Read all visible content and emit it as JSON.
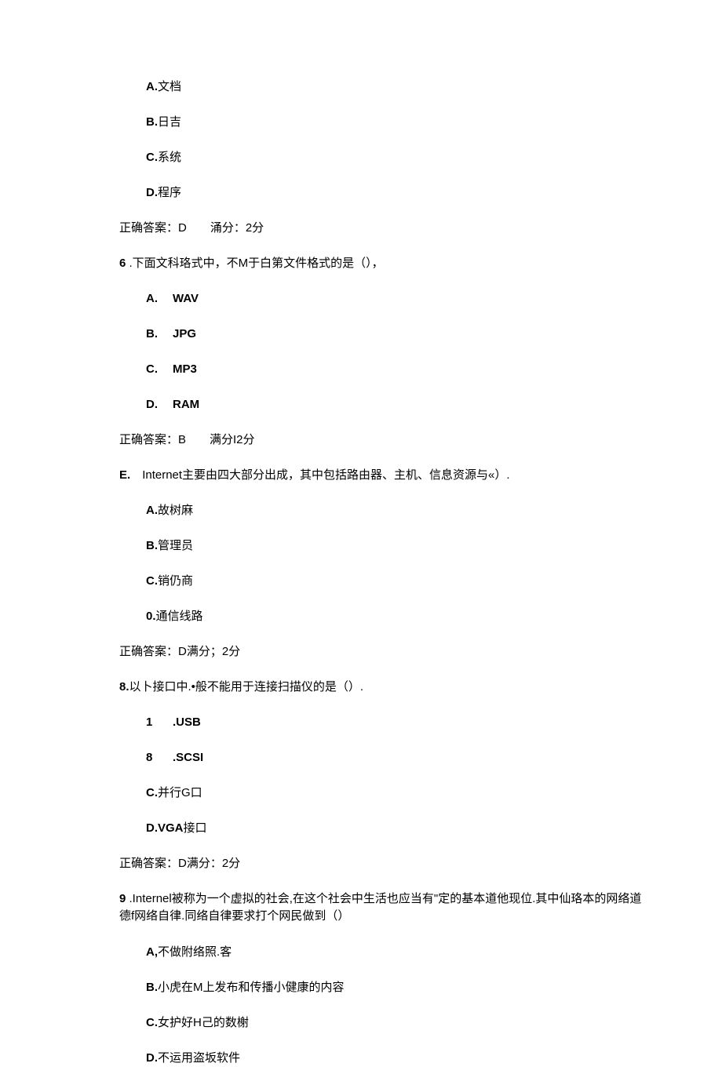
{
  "q5": {
    "optA": {
      "label": "A.",
      "text": "文档"
    },
    "optB": {
      "label": "B.",
      "text": "日吉"
    },
    "optC": {
      "label": "C.",
      "text": "系统"
    },
    "optD": {
      "label": "D.",
      "text": "程序"
    },
    "answer": "正确答案：D　　涌分：2分"
  },
  "q6": {
    "stem_num": "6",
    "stem_text": " .下面文科珞式中，不M于白第文件格式的是（），",
    "optA": {
      "label": "A.",
      "text": "WAV"
    },
    "optB": {
      "label": "B.",
      "text": "JPG"
    },
    "optC": {
      "label": "C.",
      "text": "MP3"
    },
    "optD": {
      "label": "D.",
      "text": "RAM"
    },
    "answer": "正确答案：B　　满分I2分"
  },
  "q7": {
    "stem_num": "E.",
    "stem_text": "　Internet主要由四大部分出成，其中包括路由器、主机、信息资源与«）.",
    "optA": {
      "label": "A.",
      "text": "故树麻"
    },
    "optB": {
      "label": "B.",
      "text": "管理员"
    },
    "optC": {
      "label": "C.",
      "text": "销仍商"
    },
    "optD": {
      "label": "0.",
      "text": "通信线路"
    },
    "answer": "正确答案：D满分；2分"
  },
  "q8": {
    "stem_num": "8.",
    "stem_text": "以卜接口中.•般不能用于连接扫描仪的是（）.",
    "optA": {
      "label": "1",
      "text": ".USB"
    },
    "optB": {
      "label": "8",
      "text": ".SCSI"
    },
    "optC": {
      "label": "C.",
      "text": "并行G口"
    },
    "optD": {
      "label": "D.VGA",
      "text": "接口"
    },
    "answer": "正确答案：D满分：2分"
  },
  "q9": {
    "stem_num": "9",
    "stem_text": " .Internel被称为一个虚拟的社会,在这个社会中生活也应当有\"定的基本道他现位.其中仙珞本的网络道德f网络自律.同络自律要求打个网民做到（）",
    "optA": {
      "label": "A,",
      "text": "不做附络照.客"
    },
    "optB": {
      "label": "B.",
      "text": "小虎在M上发布和传播小健康的内容"
    },
    "optC": {
      "label": "C.",
      "text": "女护好H己的数榭"
    },
    "optD": {
      "label": "D.",
      "text": "不运用盗坂软件"
    }
  }
}
